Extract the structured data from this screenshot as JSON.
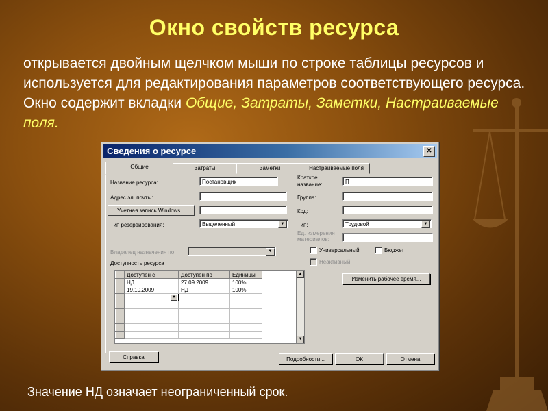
{
  "slide": {
    "title": "Окно свойств ресурса",
    "text_1": "открывается двойным щелчком мыши по строке таблицы ресурсов и используется для редактирования параметров соответствующего ресурса. Окно содержит вкладки ",
    "text_tabs": "Общие, Затраты, Заметки, Настраиваемые поля.",
    "footnote": "Значение НД означает неограниченный срок."
  },
  "dialog": {
    "title": "Сведения о ресурсе",
    "close_icon": "close-icon",
    "tabs": [
      {
        "label": "Общие",
        "active": true
      },
      {
        "label": "Затраты",
        "active": false
      },
      {
        "label": "Заметки",
        "active": false
      },
      {
        "label": "Настраиваемые поля",
        "active": false
      }
    ],
    "fields": {
      "name_label": "Название ресурса:",
      "name_value": "Постановщик",
      "email_label": "Адрес эл. почты:",
      "email_value": "",
      "windows_account_button": "Учетная запись Windows...",
      "windows_account_value": "",
      "booking_type_label": "Тип резервирования:",
      "booking_type_value": "Выделенный",
      "assignment_owner_label": "Владелец назначения по",
      "assignment_owner_value": "",
      "short_name_label": "Краткое название:",
      "short_name_value": "П",
      "group_label": "Группа:",
      "group_value": "",
      "code_label": "Код:",
      "code_value": "",
      "type_label": "Тип:",
      "type_value": "Трудовой",
      "material_label": "Ед. измерения материалов:",
      "material_value": "",
      "generic_label": "Универсальный",
      "budget_label": "Бюджет",
      "inactive_label": "Неактивный",
      "change_calendar_button": "Изменить рабочее время..."
    },
    "availability": {
      "label": "Доступность ресурса",
      "columns": [
        "Доступен с",
        "Доступен по",
        "Единицы"
      ],
      "rows": [
        [
          "НД",
          "27.09.2009",
          "100%"
        ],
        [
          "19.10.2009",
          "НД",
          "100%"
        ]
      ]
    },
    "buttons": {
      "help": "Справка",
      "details": "Подробности...",
      "ok": "ОК",
      "cancel": "Отмена"
    }
  },
  "colors": {
    "title_yellow": "#ffff66",
    "titlebar": "#0a246a",
    "dialog_gray": "#d4d0c8"
  }
}
